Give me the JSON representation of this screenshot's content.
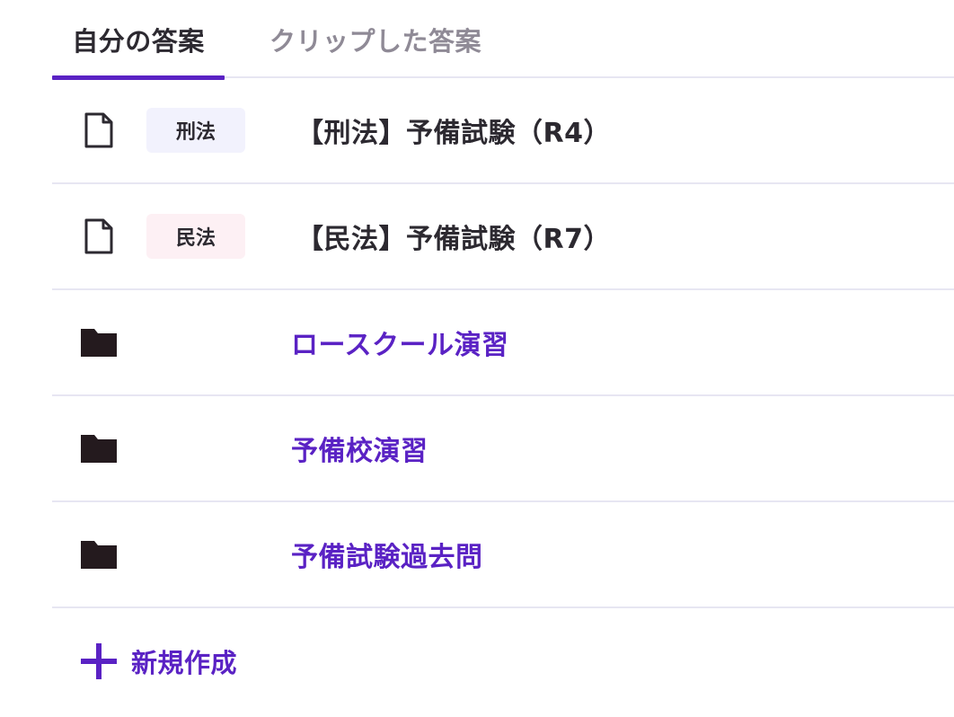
{
  "tabs": {
    "own": "自分の答案",
    "clipped": "クリップした答案"
  },
  "items": [
    {
      "type": "document",
      "badge": "刑法",
      "title": "【刑法】予備試験（R4）"
    },
    {
      "type": "document",
      "badge": "民法",
      "title": "【民法】予備試験（R7）"
    },
    {
      "type": "folder",
      "title": "ロースクール演習"
    },
    {
      "type": "folder",
      "title": "予備校演習"
    },
    {
      "type": "folder",
      "title": "予備試験過去問"
    }
  ],
  "new_button": {
    "label": "新規作成"
  },
  "colors": {
    "accent": "#5a22c4",
    "text": "#2c2930",
    "inactive_tab": "#8f8a96",
    "divider": "#e7e6f2",
    "badge_criminal_bg": "#f2f2fd",
    "badge_civil_bg": "#fdf0f4"
  },
  "icons": {
    "document": "document-icon",
    "folder": "folder-icon",
    "add": "plus-icon"
  }
}
